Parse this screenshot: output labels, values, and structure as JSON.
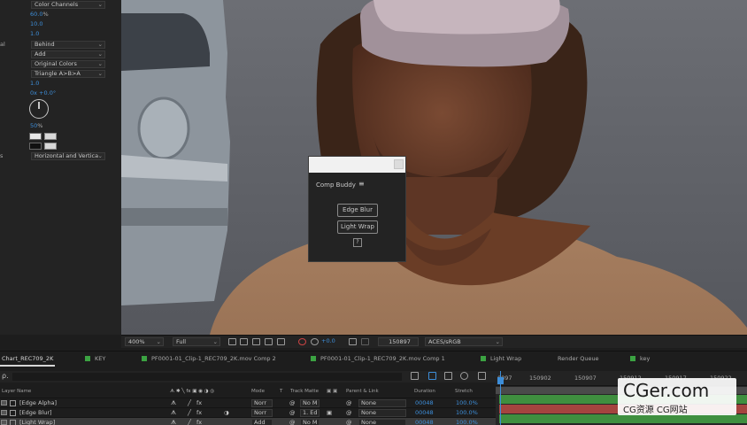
{
  "effect_controls": {
    "rows": [
      {
        "label": "",
        "value": "Color Channels",
        "kind": "dropdown"
      },
      {
        "label": "",
        "value": "60.0",
        "unit": "%",
        "kind": "number"
      },
      {
        "label": "",
        "value": "10.0",
        "unit": "",
        "kind": "number"
      },
      {
        "label": "",
        "value": "1.0",
        "unit": "",
        "kind": "number"
      },
      {
        "label": "al",
        "value": "Behind",
        "kind": "dropdown"
      },
      {
        "label": "",
        "value": "Add",
        "kind": "dropdown"
      },
      {
        "label": "",
        "value": "Original Colors",
        "kind": "dropdown"
      },
      {
        "label": "",
        "value": "Triangle A>B>A",
        "kind": "dropdown"
      },
      {
        "label": "",
        "value": "1.0",
        "unit": "",
        "kind": "number"
      },
      {
        "label": "",
        "value": "0x +0.0°",
        "unit": "",
        "kind": "number"
      },
      {
        "label": "",
        "value": "50",
        "unit": "%",
        "kind": "number"
      },
      {
        "label": "s",
        "value": "Horizontal and Vertica",
        "kind": "dropdown"
      }
    ]
  },
  "comp_buddy": {
    "title": "Comp Buddy",
    "menu_icon": "≡",
    "buttons": [
      "Edge Blur",
      "Light Wrap"
    ],
    "help": "?"
  },
  "viewer_bar": {
    "zoom": "400%",
    "resolution": "Full",
    "exposure": "+0.0",
    "timecode": "150897",
    "color_space": "ACES/sRGB"
  },
  "tabs": [
    {
      "label": "Chart_REC709_2K",
      "active": true,
      "color": ""
    },
    {
      "label": "KEY",
      "active": false,
      "color": "#3ba342"
    },
    {
      "label": "PF0001-01_Clip-1_REC709_2K.mov Comp 2",
      "active": false,
      "color": "#3ba342"
    },
    {
      "label": "PF0001-01_Clip-1_REC709_2K.mov Comp 1",
      "active": false,
      "color": "#3ba342"
    },
    {
      "label": "Light Wrap",
      "active": false,
      "color": "#3ba342"
    },
    {
      "label": "Render Queue",
      "active": false,
      "color": ""
    },
    {
      "label": "key",
      "active": false,
      "color": "#3ba342"
    }
  ],
  "timeline": {
    "search_icon": "ρ.",
    "columns": {
      "layer_name": "Layer Name",
      "mode": "Mode",
      "t": "T",
      "track_matte": "Track Matte",
      "parent": "Parent & Link",
      "duration": "Duration",
      "stretch": "Stretch"
    },
    "layers": [
      {
        "name": "[Edge Alpha]",
        "mode": "Norr",
        "matte": "No M",
        "parent": "None",
        "duration": "00048",
        "stretch": "100.0%"
      },
      {
        "name": "[Edge Blur]",
        "mode": "Norr",
        "matte": "1. Ed",
        "parent": "None",
        "duration": "00048",
        "stretch": "100.0%"
      },
      {
        "name": "[Light Wrap]",
        "mode": "Add",
        "matte": "No M",
        "parent": "None",
        "duration": "00048",
        "stretch": "100.0%"
      }
    ],
    "ruler": [
      "0897",
      "150902",
      "150907",
      "150912",
      "150917",
      "150922",
      "150927"
    ],
    "bar_colors": [
      "#3f8f3f",
      "#a5443f",
      "#3f8f3f"
    ]
  },
  "watermark": {
    "main": "CGer.com",
    "sub": "CG资源 CG网站"
  }
}
